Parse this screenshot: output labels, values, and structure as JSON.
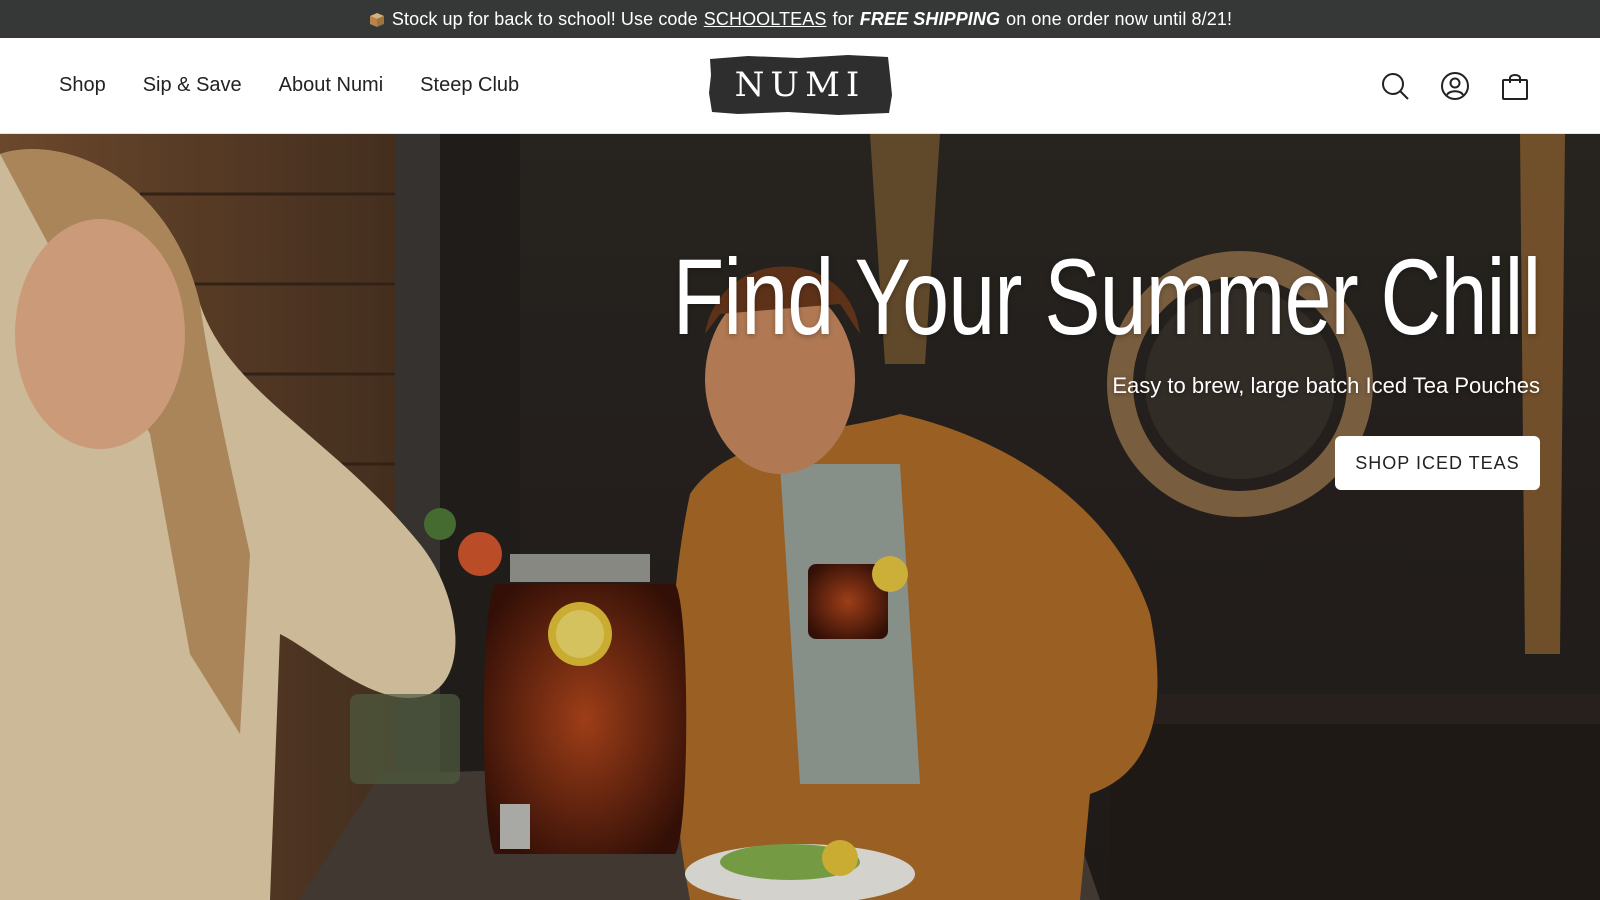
{
  "announcement": {
    "prefix": "Stock up for back to school! Use code",
    "code": "SCHOOLTEAS",
    "middle": "for",
    "free": "FREE SHIPPING",
    "suffix": "on one order now until 8/21!",
    "icon": "package-icon"
  },
  "nav": {
    "items": [
      {
        "label": "Shop"
      },
      {
        "label": "Sip & Save"
      },
      {
        "label": "About Numi"
      },
      {
        "label": "Steep Club"
      }
    ]
  },
  "logo": {
    "text": "NUMI"
  },
  "header_icons": [
    "search-icon",
    "account-icon",
    "cart-icon"
  ],
  "hero": {
    "title": "Find Your Summer Chill",
    "subtitle": "Easy to brew, large batch Iced Tea Pouches",
    "cta_label": "SHOP ICED TEAS"
  },
  "colors": {
    "announcement_bg": "#353837",
    "header_bg": "#ffffff",
    "logo_bg": "#2e2e2e",
    "text_dark": "#222222",
    "hero_bg": "#2b2622",
    "cta_bg": "#ffffff"
  }
}
